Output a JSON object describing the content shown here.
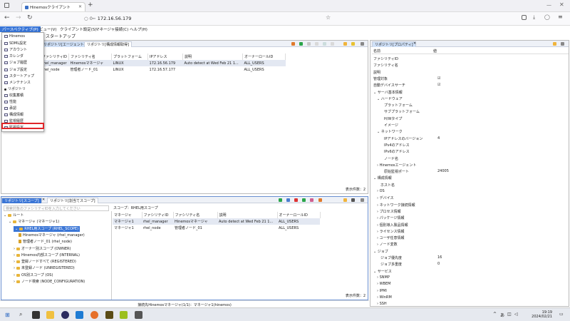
{
  "browser": {
    "tab_title": "Hinemosクライアント",
    "new_tab": "+",
    "url_prefix": "○ 0┅",
    "url": "172.16.56.179"
  },
  "app_menu": [
    "パースペクティブ(P)",
    "ビュー(V)",
    "クライアント設定(S)",
    "マネージャ接続(C)",
    "ヘルプ(H)"
  ],
  "perspective_title": "スタートアップ",
  "dropdown_items": [
    "Hinemos",
    "SDML設定",
    "アカウント",
    "カレンダ",
    "ジョブ履歴",
    "ジョブ設定",
    "スタートアップ",
    "メンテナンス",
    "リポジトリ",
    "収集蓄積",
    "性能",
    "承認",
    "構成情報",
    "監視履歴",
    "監視設定"
  ],
  "dropdown_selected": "リポジトリ",
  "top_left_panel": {
    "tabs": [
      "リポジトリ[エージェント]",
      "リポジトリ[構成情報取得]"
    ],
    "columns": [
      "ファシリティID",
      "ファシリティ名",
      "プラットフォーム",
      "IPアドレス",
      "説明",
      "オーナーロールID"
    ],
    "rows": [
      [
        "rhel_manager",
        "Hinemosマネージャ",
        "LINUX",
        "172.16.56.179",
        "Auto detect at Wed Feb 21 1...",
        "ALL_USERS"
      ],
      [
        "rhel_node",
        "管理者ノード_01",
        "LINUX",
        "172.16.57.177",
        "",
        "ALL_USERS"
      ]
    ],
    "display_count": "表示件数：2"
  },
  "properties_panel": {
    "tab": "リポジトリ[プロパティ]",
    "col_name": "名前",
    "col_value": "値",
    "rows": [
      {
        "k": "ファシリティID",
        "v": "",
        "indent": 1
      },
      {
        "k": "ファシリティ名",
        "v": "",
        "indent": 1
      },
      {
        "k": "説明",
        "v": "",
        "indent": 1
      },
      {
        "k": "管理対象",
        "v": "☑",
        "indent": 1
      },
      {
        "k": "自動デバイスサーチ",
        "v": "☑",
        "indent": 1
      },
      {
        "k": "⌄ サーバ基本情報",
        "v": "",
        "indent": 1
      },
      {
        "k": "⌄ ハードウェア",
        "v": "",
        "indent": 2
      },
      {
        "k": "プラットフォーム",
        "v": "",
        "indent": 4
      },
      {
        "k": "サブプラットフォーム",
        "v": "",
        "indent": 4
      },
      {
        "k": "H/Wタイプ",
        "v": "",
        "indent": 4
      },
      {
        "k": "イメージ",
        "v": "",
        "indent": 4
      },
      {
        "k": "⌄ ネットワーク",
        "v": "",
        "indent": 2
      },
      {
        "k": "IPアドレスのバージョン",
        "v": "4",
        "indent": 4
      },
      {
        "k": "IPv4のアドレス",
        "v": "",
        "indent": 4
      },
      {
        "k": "IPv6のアドレス",
        "v": "",
        "indent": 4
      },
      {
        "k": "ノード名",
        "v": "",
        "indent": 4
      },
      {
        "k": "› Hinemosエージェント",
        "v": "",
        "indent": 2
      },
      {
        "k": "原始監視ポート",
        "v": "24005",
        "indent": 4
      },
      {
        "k": "⌄ 構成情報",
        "v": "",
        "indent": 1
      },
      {
        "k": "ホスト名",
        "v": "",
        "indent": 3
      },
      {
        "k": "› OS",
        "v": "",
        "indent": 2
      },
      {
        "k": "› デバイス",
        "v": "",
        "indent": 2
      },
      {
        "k": "› ネットワーク接続情報",
        "v": "",
        "indent": 2
      },
      {
        "k": "› プロセス情報",
        "v": "",
        "indent": 2
      },
      {
        "k": "› パッケージ情報",
        "v": "",
        "indent": 2
      },
      {
        "k": "› 個別導入製品情報",
        "v": "",
        "indent": 2
      },
      {
        "k": "› ライセンス情報",
        "v": "",
        "indent": 2
      },
      {
        "k": "› ユーザ任意情報",
        "v": "",
        "indent": 2
      },
      {
        "k": "› ノード変数",
        "v": "",
        "indent": 2
      },
      {
        "k": "⌄ ジョブ",
        "v": "",
        "indent": 1
      },
      {
        "k": "ジョブ優先度",
        "v": "16",
        "indent": 3
      },
      {
        "k": "ジョブ多重度",
        "v": "0",
        "indent": 3
      },
      {
        "k": "⌄ サービス",
        "v": "",
        "indent": 1
      },
      {
        "k": "› SNMP",
        "v": "",
        "indent": 2
      },
      {
        "k": "› WBEM",
        "v": "",
        "indent": 2
      },
      {
        "k": "› IPMI",
        "v": "",
        "indent": 2
      },
      {
        "k": "› WinRM",
        "v": "",
        "indent": 2
      },
      {
        "k": "› SSH",
        "v": "",
        "indent": 2
      }
    ]
  },
  "scope_panel": {
    "tabs": [
      "リポジトリ[スコープ]",
      "リポジトリ[割当てスコープ]"
    ],
    "search_placeholder": "検索対象のファシリティIDを入力してください",
    "scope_label": "スコープ：RHEL用スコープ",
    "tree": [
      {
        "label": "ルート",
        "level": 0,
        "kind": "root"
      },
      {
        "label": "マネージャ (マネージャ1)",
        "level": 1,
        "kind": "folder"
      },
      {
        "label": "RHEL用スコープ (RHEL_SCOPE)",
        "level": 2,
        "kind": "folder",
        "selected": true
      },
      {
        "label": "Hinemosマネージャ (rhel_manager)",
        "level": 3,
        "kind": "node"
      },
      {
        "label": "管理者ノード_01 (rhel_node)",
        "level": 3,
        "kind": "node"
      },
      {
        "label": "オーナー別スコープ (OWNER)",
        "level": 2,
        "kind": "folder"
      },
      {
        "label": "Hinemos内部スコープ (INTERNAL)",
        "level": 2,
        "kind": "folder"
      },
      {
        "label": "登録ノードすべて (REGISTERED)",
        "level": 2,
        "kind": "folder"
      },
      {
        "label": "未登録ノード (UNREGISTERED)",
        "level": 2,
        "kind": "folder"
      },
      {
        "label": "OS別スコープ (OS)",
        "level": 2,
        "kind": "folder"
      },
      {
        "label": "ノード検索 (NODE_CONFIGURATION)",
        "level": 2,
        "kind": "folder"
      }
    ],
    "columns": [
      "マネージャ",
      "ファシリティID",
      "ファシリティ名",
      "説明",
      "オーナーロールID"
    ],
    "rows": [
      [
        "マネージャ1",
        "rhel_manager",
        "Hinemosマネージャ",
        "Auto detect at Wed Feb 21 1...",
        "ALL_USERS"
      ],
      [
        "マネージャ1",
        "rhel_node",
        "管理者ノード_01",
        "",
        "ALL_USERS"
      ]
    ],
    "display_count": "表示件数：2"
  },
  "status_bar": "接続先Hinemosマネージャ(1/1)：マネージャ1(hinemos)",
  "taskbar": {
    "time": "19:19",
    "date": "2024/02/21",
    "ime": "あ",
    "chevron": "^"
  }
}
